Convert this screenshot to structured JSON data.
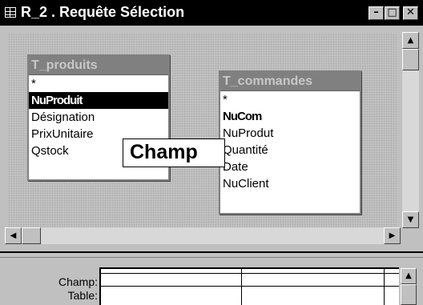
{
  "window": {
    "title": "R_2 . Requête Sélection",
    "controls": {
      "minimize": "–",
      "maximize": "□",
      "close": "✕"
    }
  },
  "design": {
    "tables": [
      {
        "name": "T_produits",
        "fields": [
          {
            "label": "*",
            "key": false,
            "selected": false
          },
          {
            "label": "NuProduit",
            "key": true,
            "selected": true
          },
          {
            "label": "Désignation",
            "key": false,
            "selected": false
          },
          {
            "label": "PrixUnitaire",
            "key": false,
            "selected": false
          },
          {
            "label": "Qstock",
            "key": false,
            "selected": false
          }
        ]
      },
      {
        "name": "T_commandes",
        "fields": [
          {
            "label": "*",
            "key": false,
            "selected": false
          },
          {
            "label": "NuCom",
            "key": true,
            "selected": false
          },
          {
            "label": "NuProdut",
            "key": false,
            "selected": false
          },
          {
            "label": "Quantité",
            "key": false,
            "selected": false
          },
          {
            "label": "Date",
            "key": false,
            "selected": false
          },
          {
            "label": "NuClient",
            "key": false,
            "selected": false
          }
        ]
      }
    ],
    "tooltip": "Champ"
  },
  "scroll_icons": {
    "up": "▲",
    "down": "▼",
    "left": "◀",
    "right": "▶"
  },
  "grid": {
    "row_labels": [
      "Champ:",
      "Table:"
    ]
  }
}
